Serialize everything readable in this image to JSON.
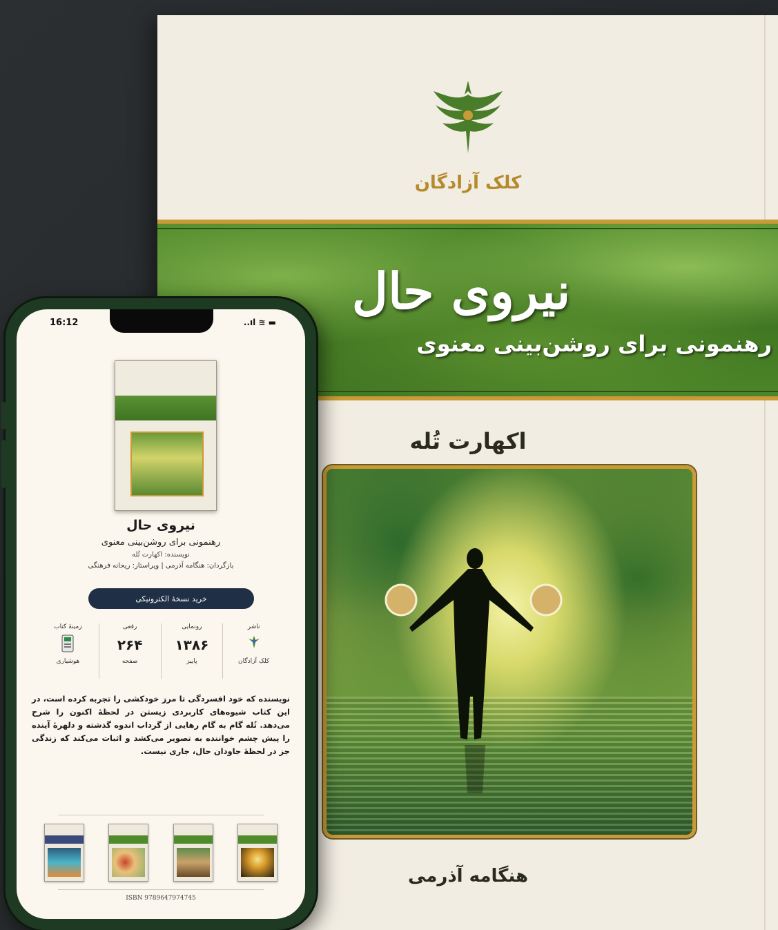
{
  "book": {
    "publisher": "کلک آزادگان",
    "title": "نیروی حال",
    "subtitle": "رهنمونی برای روشن‌بینی معنوی",
    "author": "اکهارت تُله",
    "translator": "هنگامه آذرمی"
  },
  "phone": {
    "status": {
      "time": "16:12",
      "icons": "..ıl ≋ ▬"
    },
    "app": {
      "title": "نیروی حال",
      "subtitle": "رهنمونی برای روشن‌بینی معنوی",
      "author_line": "نویسنده: اکهارت تُله",
      "credits_line": "بازگردان: هنگامه آذرمی | ویراستار: ریحانه فرهنگی",
      "buy_label": "خرید نسخهٔ الکترونیکی"
    },
    "meta": [
      {
        "label": "ناشر",
        "value": "",
        "sub": "کلک آزادگان",
        "icon": "publisher-logo-icon"
      },
      {
        "label": "رونمایی",
        "value": "۱۳۸۶",
        "sub": "پاییز"
      },
      {
        "label": "رقعی",
        "value": "۲۶۴",
        "sub": "صفحه"
      },
      {
        "label": "زمینهٔ کتاب",
        "value": "",
        "sub": "هوشیاری",
        "icon": "calculator-icon"
      }
    ],
    "description": "نویسنده که خود افسردگی تا مرز خودکشی را تجربه کرده است، در این کتاب شیوه‌های کاربردی زیستن در لحظهٔ اکنون را شرح می‌دهد. تُله گام به گام رهایی از گرداب اندوه گذشته و دلهرهٔ آینده را پیش چشم خواننده به تصویر می‌کشد و اثبات می‌کند که زندگی جز در لحظهٔ جاودان حال، جاری نیست.",
    "isbn": "ISBN 9789647974745"
  },
  "colors": {
    "gold": "#c99a36",
    "green": "#4f8a2b",
    "button": "#1f2f45",
    "phone_frame": "#1f3a22"
  }
}
